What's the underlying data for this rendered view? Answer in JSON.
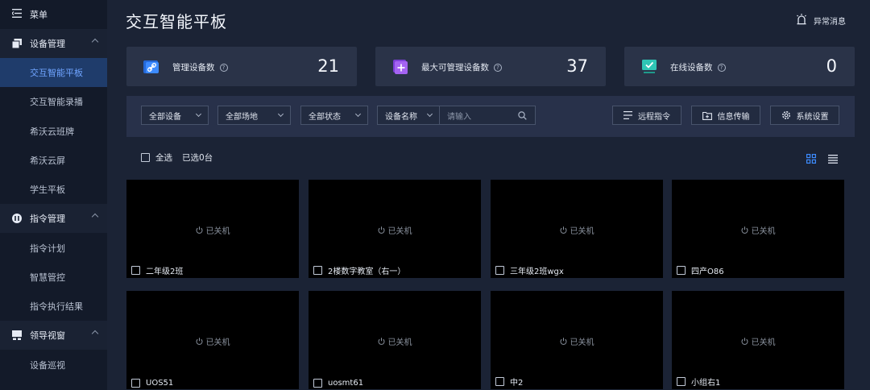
{
  "sidebar": {
    "menu_label": "菜单",
    "groups": [
      {
        "label": "设备管理",
        "items": [
          {
            "label": "交互智能平板",
            "active": true
          },
          {
            "label": "交互智能录播"
          },
          {
            "label": "希沃云班牌"
          },
          {
            "label": "希沃云屏"
          },
          {
            "label": "学生平板"
          }
        ]
      },
      {
        "label": "指令管理",
        "items": [
          {
            "label": "指令计划"
          },
          {
            "label": "智慧管控"
          },
          {
            "label": "指令执行结果"
          }
        ]
      },
      {
        "label": "领导视窗",
        "items": [
          {
            "label": "设备巡视"
          }
        ]
      }
    ]
  },
  "header": {
    "title": "交互智能平板",
    "alerts_label": "异常消息"
  },
  "stats": [
    {
      "label": "管理设备数",
      "value": "21",
      "icon": "link-icon",
      "color": "#3d8bff"
    },
    {
      "label": "最大可管理设备数",
      "value": "37",
      "icon": "plus-square-icon",
      "color": "#a463f2"
    },
    {
      "label": "在线设备数",
      "value": "0",
      "icon": "monitor-check-icon",
      "color": "#2fc6b5"
    }
  ],
  "filters": {
    "device_select": "全部设备",
    "venue_select": "全部场地",
    "status_select": "全部状态",
    "field_select": "设备名称",
    "search_placeholder": "请输入"
  },
  "actions": {
    "remote_command": "远程指令",
    "info_transfer": "信息传输",
    "system_settings": "系统设置"
  },
  "selection": {
    "select_all": "全选",
    "selected_count": "已选0台"
  },
  "devices": [
    {
      "name": "二年级2班",
      "status": "已关机"
    },
    {
      "name": "2楼数字教室（右一）",
      "status": "已关机"
    },
    {
      "name": "三年级2班wgx",
      "status": "已关机"
    },
    {
      "name": "四产O86",
      "status": "已关机"
    },
    {
      "name": "UOS51",
      "status": "已关机"
    },
    {
      "name": "uosmt61",
      "status": "已关机"
    },
    {
      "name": "中2",
      "status": "已关机"
    },
    {
      "name": "小组右1",
      "status": "已关机"
    }
  ],
  "colors": {
    "accent": "#3d8bff",
    "sidebar_bg": "#131a29",
    "page_bg": "#1b2335",
    "active_item_bg": "#1f3c6b"
  }
}
